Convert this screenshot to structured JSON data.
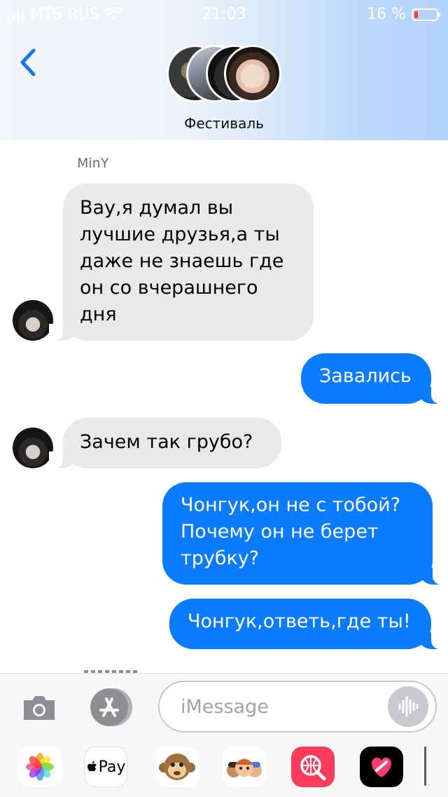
{
  "status_bar": {
    "carrier": "MTS RUS",
    "time": "21:03",
    "battery": "16 %",
    "battery_level": 0.16
  },
  "header": {
    "back_icon": "chevron-left-icon",
    "group_name": "Фестиваль"
  },
  "messages": [
    {
      "sender": "MinY",
      "direction": "incoming",
      "text": "Вау,я думал вы\nлучшие друзья,а ты\nдаже не знаешь где\nон со вчерашнего\nдня"
    },
    {
      "direction": "outgoing",
      "text": "Завались"
    },
    {
      "direction": "incoming",
      "text": "Зачем так грубо?"
    },
    {
      "direction": "outgoing",
      "text": "Чонгук,он не с тобой?\nПочему он не берет\nтрубку?"
    },
    {
      "direction": "outgoing",
      "text": "Чонгук,ответь,где ты!"
    }
  ],
  "compose": {
    "placeholder": "iMessage",
    "apple_pay_label": "Pay"
  },
  "colors": {
    "outgoing_bubble": "#0b7bff",
    "incoming_bubble": "#e9e9eb",
    "accent": "#1677f2"
  }
}
